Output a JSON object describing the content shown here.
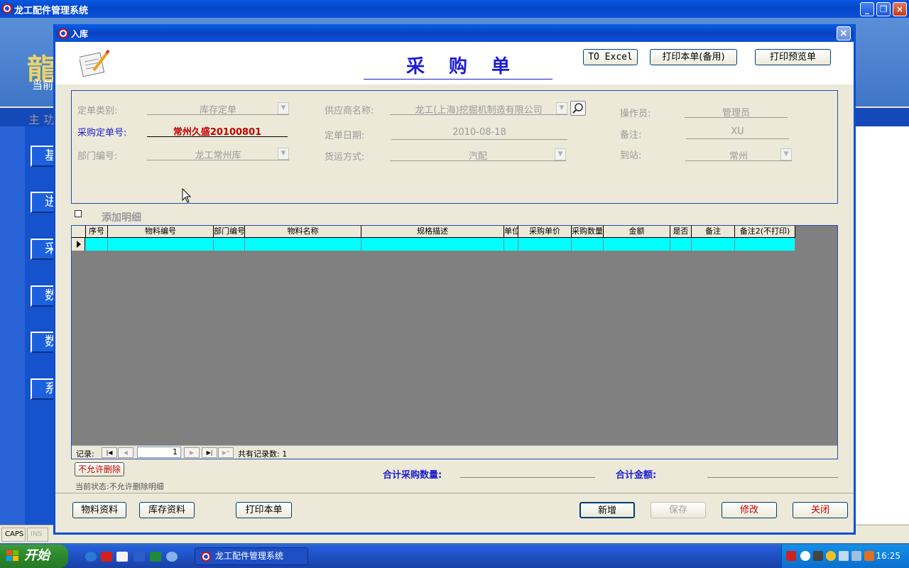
{
  "app": {
    "title": "龙工配件管理系统",
    "banner_char": "龍",
    "current_label": "当前",
    "main_menu_label": "主 功"
  },
  "left_buttons": [
    "基",
    "进",
    "采",
    "数",
    "数",
    "系"
  ],
  "statusbar": {
    "caps": "CAPS",
    "ins": "INS"
  },
  "child": {
    "title": "入库",
    "close": "×"
  },
  "header": {
    "form_title": "采购单",
    "btn_excel": "TO Excel",
    "btn_print_backup": "打印本单(备用)",
    "btn_print_preview": "打印预览单"
  },
  "form": {
    "order_type_label": "定单类别:",
    "order_type_value": "库存定单",
    "supplier_label": "供应商名称:",
    "supplier_value": "龙工(上海)挖掘机制造有限公司",
    "operator_label": "操作员:",
    "operator_value": "管理员",
    "po_number_label": "采购定单号:",
    "po_number_value": "常州久盛20100801",
    "order_date_label": "定单日期:",
    "order_date_value": "2010-08-18",
    "remark_label": "备注:",
    "remark_value": "XU",
    "dept_label": "部门编号:",
    "dept_value": "龙工常州库",
    "shipping_label": "货运方式:",
    "shipping_value": "汽配",
    "station_label": "到站:",
    "station_value": "常州"
  },
  "add_detail_label": "添加明细",
  "grid": {
    "columns": [
      "序号",
      "物料编号",
      "部门编号",
      "物料名称",
      "规格描述",
      "单位",
      "采购单价",
      "采购数量",
      "金额",
      "是否",
      "备注",
      "备注2(不打印)"
    ],
    "record_label": "记录:",
    "current_record": "1",
    "total_text": "共有记录数: 1"
  },
  "footer": {
    "no_delete_btn": "不允许删除",
    "state_text": "当前状态:不允许删除明细",
    "total_qty_label": "合计采购数量:",
    "total_amount_label": "合计金额:",
    "btn_material": "物料资料",
    "btn_stock": "库存资料",
    "btn_print": "打印本单",
    "btn_new": "新增",
    "btn_save": "保存",
    "btn_modify": "修改",
    "btn_close": "关闭"
  },
  "taskbar": {
    "start_label": "开始",
    "task_label": "龙工配件管理系统",
    "clock": "16:25"
  }
}
